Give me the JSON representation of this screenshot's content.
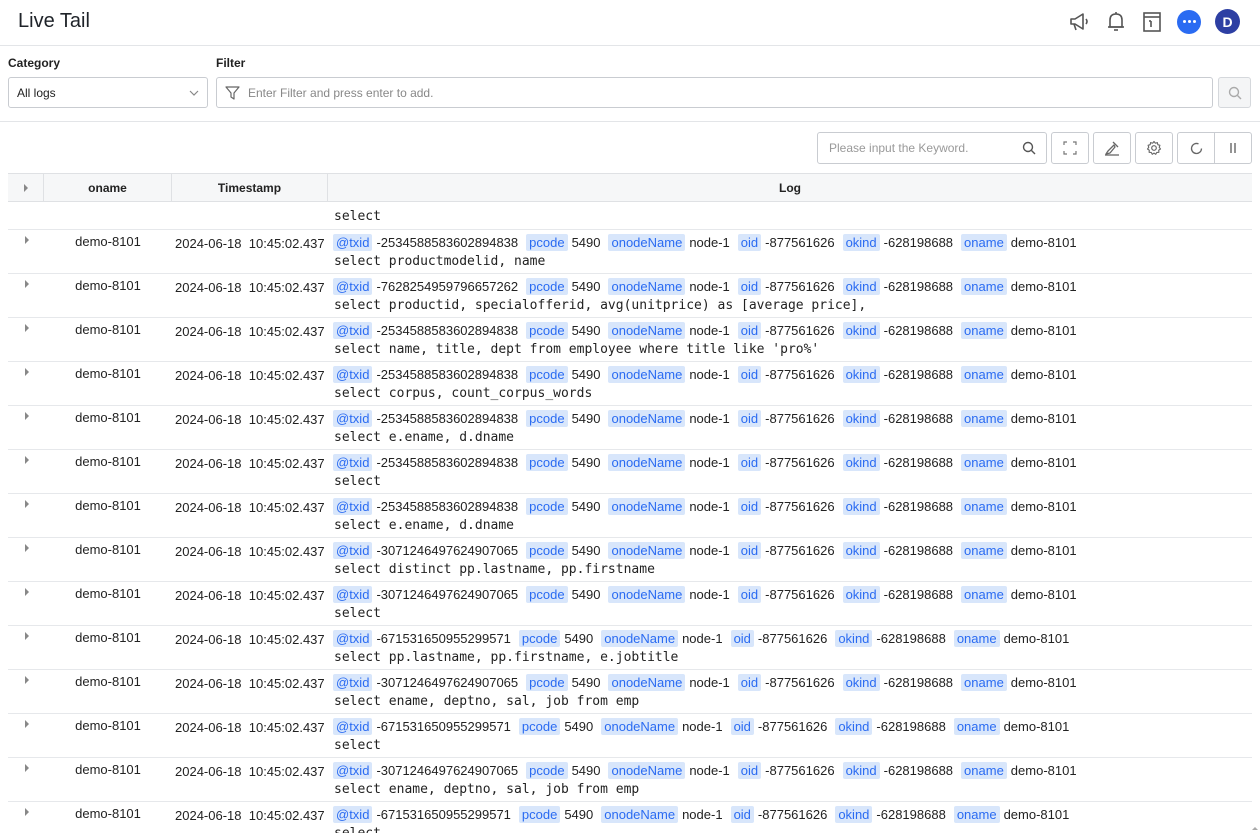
{
  "header": {
    "title": "Live Tail",
    "avatar_letter": "D"
  },
  "filters": {
    "category_label": "Category",
    "category_value": "All logs",
    "filter_label": "Filter",
    "filter_placeholder": "Enter Filter and press enter to add."
  },
  "toolbar": {
    "keyword_placeholder": "Please input the Keyword."
  },
  "table": {
    "columns": [
      "oname",
      "Timestamp",
      "Log"
    ],
    "first_fragment_sql": "select",
    "rows": [
      {
        "oname": "demo-8101",
        "date": "2024-06-18",
        "time": "10:45:02.437",
        "txid": "-2534588583602894838",
        "pcode": "5490",
        "onodeName": "node-1",
        "oid": "-877561626",
        "okind": "-628198688",
        "oname_val": "demo-8101",
        "sql": "select productmodelid, name"
      },
      {
        "oname": "demo-8101",
        "date": "2024-06-18",
        "time": "10:45:02.437",
        "txid": "-7628254959796657262",
        "pcode": "5490",
        "onodeName": "node-1",
        "oid": "-877561626",
        "okind": "-628198688",
        "oname_val": "demo-8101",
        "sql": "select productid, specialofferid, avg(unitprice) as [average price],"
      },
      {
        "oname": "demo-8101",
        "date": "2024-06-18",
        "time": "10:45:02.437",
        "txid": "-2534588583602894838",
        "pcode": "5490",
        "onodeName": "node-1",
        "oid": "-877561626",
        "okind": "-628198688",
        "oname_val": "demo-8101",
        "sql": "select name, title, dept from employee where title like 'pro%'"
      },
      {
        "oname": "demo-8101",
        "date": "2024-06-18",
        "time": "10:45:02.437",
        "txid": "-2534588583602894838",
        "pcode": "5490",
        "onodeName": "node-1",
        "oid": "-877561626",
        "okind": "-628198688",
        "oname_val": "demo-8101",
        "sql": "select corpus, count_corpus_words"
      },
      {
        "oname": "demo-8101",
        "date": "2024-06-18",
        "time": "10:45:02.437",
        "txid": "-2534588583602894838",
        "pcode": "5490",
        "onodeName": "node-1",
        "oid": "-877561626",
        "okind": "-628198688",
        "oname_val": "demo-8101",
        "sql": "select e.ename, d.dname"
      },
      {
        "oname": "demo-8101",
        "date": "2024-06-18",
        "time": "10:45:02.437",
        "txid": "-2534588583602894838",
        "pcode": "5490",
        "onodeName": "node-1",
        "oid": "-877561626",
        "okind": "-628198688",
        "oname_val": "demo-8101",
        "sql": "select"
      },
      {
        "oname": "demo-8101",
        "date": "2024-06-18",
        "time": "10:45:02.437",
        "txid": "-2534588583602894838",
        "pcode": "5490",
        "onodeName": "node-1",
        "oid": "-877561626",
        "okind": "-628198688",
        "oname_val": "demo-8101",
        "sql": "select e.ename, d.dname"
      },
      {
        "oname": "demo-8101",
        "date": "2024-06-18",
        "time": "10:45:02.437",
        "txid": "-3071246497624907065",
        "pcode": "5490",
        "onodeName": "node-1",
        "oid": "-877561626",
        "okind": "-628198688",
        "oname_val": "demo-8101",
        "sql": "select distinct pp.lastname, pp.firstname"
      },
      {
        "oname": "demo-8101",
        "date": "2024-06-18",
        "time": "10:45:02.437",
        "txid": "-3071246497624907065",
        "pcode": "5490",
        "onodeName": "node-1",
        "oid": "-877561626",
        "okind": "-628198688",
        "oname_val": "demo-8101",
        "sql": "select"
      },
      {
        "oname": "demo-8101",
        "date": "2024-06-18",
        "time": "10:45:02.437",
        "txid": "-671531650955299571",
        "pcode": "5490",
        "onodeName": "node-1",
        "oid": "-877561626",
        "okind": "-628198688",
        "oname_val": "demo-8101",
        "sql": "select pp.lastname, pp.firstname, e.jobtitle"
      },
      {
        "oname": "demo-8101",
        "date": "2024-06-18",
        "time": "10:45:02.437",
        "txid": "-3071246497624907065",
        "pcode": "5490",
        "onodeName": "node-1",
        "oid": "-877561626",
        "okind": "-628198688",
        "oname_val": "demo-8101",
        "sql": "select ename, deptno, sal, job from emp"
      },
      {
        "oname": "demo-8101",
        "date": "2024-06-18",
        "time": "10:45:02.437",
        "txid": "-671531650955299571",
        "pcode": "5490",
        "onodeName": "node-1",
        "oid": "-877561626",
        "okind": "-628198688",
        "oname_val": "demo-8101",
        "sql": "select"
      },
      {
        "oname": "demo-8101",
        "date": "2024-06-18",
        "time": "10:45:02.437",
        "txid": "-3071246497624907065",
        "pcode": "5490",
        "onodeName": "node-1",
        "oid": "-877561626",
        "okind": "-628198688",
        "oname_val": "demo-8101",
        "sql": "select ename, deptno, sal, job from emp"
      },
      {
        "oname": "demo-8101",
        "date": "2024-06-18",
        "time": "10:45:02.437",
        "txid": "-671531650955299571",
        "pcode": "5490",
        "onodeName": "node-1",
        "oid": "-877561626",
        "okind": "-628198688",
        "oname_val": "demo-8101",
        "sql": "select"
      }
    ]
  },
  "log_keys": {
    "txid": "@txid",
    "pcode": "pcode",
    "onodeName": "onodeName",
    "oid": "oid",
    "okind": "okind",
    "oname": "oname"
  }
}
